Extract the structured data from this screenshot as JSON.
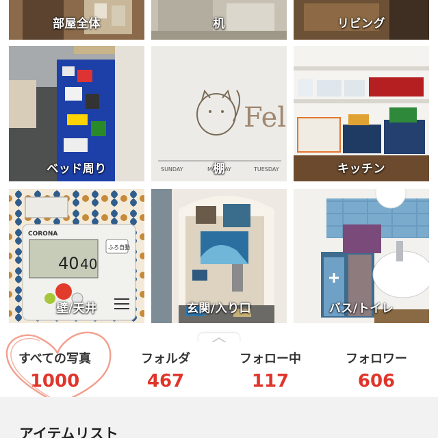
{
  "folders": [
    {
      "label": "部屋全体"
    },
    {
      "label": "机"
    },
    {
      "label": "リビング"
    },
    {
      "label": "ベッド周り"
    },
    {
      "label": "棚"
    },
    {
      "label": "キッチン"
    },
    {
      "label": "壁/天井"
    },
    {
      "label": "玄関/入り口"
    },
    {
      "label": "バス/トイレ"
    }
  ],
  "photo_text": {
    "shelf_sketch_word": "Fel",
    "shelf_weekdays": [
      "SUNDAY",
      "MONDAY",
      "TUESDAY"
    ],
    "remote_brand": "CORONA",
    "remote_readout_1": "40",
    "remote_readout_2": "40",
    "remote_button": "ふろ自動"
  },
  "stats": [
    {
      "label": "すべての写真",
      "value": "1000"
    },
    {
      "label": "フォルダ",
      "value": "467"
    },
    {
      "label": "フォロー中",
      "value": "117"
    },
    {
      "label": "フォロワー",
      "value": "606"
    }
  ],
  "item_list": {
    "title": "アイテムリスト"
  },
  "colors": {
    "accent": "#e0352b",
    "heart": "#f3a08f"
  }
}
